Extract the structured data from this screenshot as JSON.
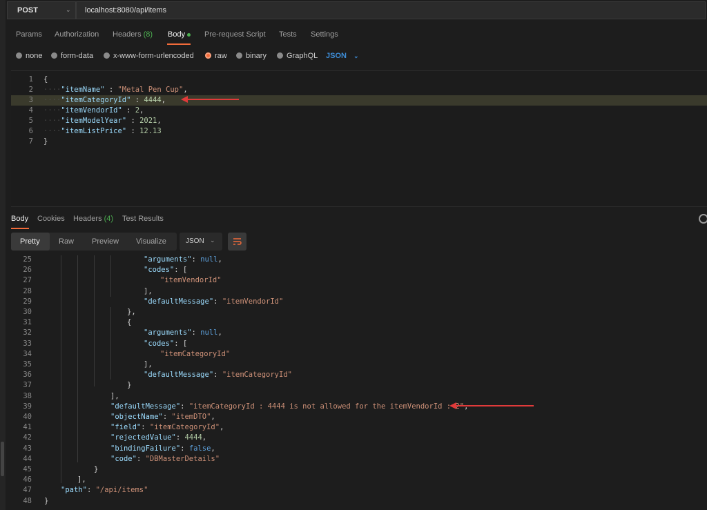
{
  "request": {
    "method": "POST",
    "url": "localhost:8080/api/items"
  },
  "request_tabs": [
    {
      "label": "Params",
      "count": null,
      "active": false
    },
    {
      "label": "Authorization",
      "count": null,
      "active": false
    },
    {
      "label": "Headers",
      "count": "(8)",
      "active": false
    },
    {
      "label": "Body",
      "count": null,
      "active": true
    },
    {
      "label": "Pre-request Script",
      "count": null,
      "active": false
    },
    {
      "label": "Tests",
      "count": null,
      "active": false
    },
    {
      "label": "Settings",
      "count": null,
      "active": false
    }
  ],
  "body_types": [
    "none",
    "form-data",
    "x-www-form-urlencoded",
    "raw",
    "binary",
    "GraphQL"
  ],
  "body_type_selected": "raw",
  "body_language": "JSON",
  "request_body": [
    {
      "n": "1",
      "text": "{"
    },
    {
      "n": "2",
      "key": "\"itemName\"",
      "sep": " : ",
      "val": "\"Metal Pen Cup\"",
      "vt": "s",
      "end": ","
    },
    {
      "n": "3",
      "key": "\"itemCategoryId\"",
      "sep": " : ",
      "val": "4444",
      "vt": "n",
      "end": ","
    },
    {
      "n": "4",
      "key": "\"itemVendorId\"",
      "sep": " : ",
      "val": "2",
      "vt": "n",
      "end": ","
    },
    {
      "n": "5",
      "key": "\"itemModelYear\"",
      "sep": " : ",
      "val": "2021",
      "vt": "n",
      "end": ","
    },
    {
      "n": "6",
      "key": "\"itemListPrice\"",
      "sep": " : ",
      "val": "12.13",
      "vt": "n",
      "end": ""
    },
    {
      "n": "7",
      "text": "}"
    }
  ],
  "response_tabs": [
    {
      "label": "Body",
      "count": null,
      "active": true
    },
    {
      "label": "Cookies",
      "count": null,
      "active": false
    },
    {
      "label": "Headers",
      "count": "(4)",
      "active": false
    },
    {
      "label": "Test Results",
      "count": null,
      "active": false
    }
  ],
  "format_tabs": [
    "Pretty",
    "Raw",
    "Preview",
    "Visualize"
  ],
  "format_selected": "Pretty",
  "response_language": "JSON",
  "response_body": [
    {
      "n": "25",
      "indent": 7,
      "key": "\"arguments\"",
      "sep": ": ",
      "val": "null",
      "vt": "kw",
      "end": ","
    },
    {
      "n": "26",
      "indent": 7,
      "key": "\"codes\"",
      "sep": ": ",
      "val": "[",
      "vt": "p",
      "end": ""
    },
    {
      "n": "27",
      "indent": 8,
      "key": "",
      "sep": "",
      "val": "\"itemVendorId\"",
      "vt": "s",
      "end": ""
    },
    {
      "n": "28",
      "indent": 7,
      "key": "",
      "sep": "",
      "val": "]",
      "vt": "p",
      "end": ","
    },
    {
      "n": "29",
      "indent": 7,
      "key": "\"defaultMessage\"",
      "sep": ": ",
      "val": "\"itemVendorId\"",
      "vt": "s",
      "end": ""
    },
    {
      "n": "30",
      "indent": 6,
      "key": "",
      "sep": "",
      "val": "}",
      "vt": "p",
      "end": ","
    },
    {
      "n": "31",
      "indent": 6,
      "key": "",
      "sep": "",
      "val": "{",
      "vt": "p",
      "end": ""
    },
    {
      "n": "32",
      "indent": 7,
      "key": "\"arguments\"",
      "sep": ": ",
      "val": "null",
      "vt": "kw",
      "end": ","
    },
    {
      "n": "33",
      "indent": 7,
      "key": "\"codes\"",
      "sep": ": ",
      "val": "[",
      "vt": "p",
      "end": ""
    },
    {
      "n": "34",
      "indent": 8,
      "key": "",
      "sep": "",
      "val": "\"itemCategoryId\"",
      "vt": "s",
      "end": ""
    },
    {
      "n": "35",
      "indent": 7,
      "key": "",
      "sep": "",
      "val": "]",
      "vt": "p",
      "end": ","
    },
    {
      "n": "36",
      "indent": 7,
      "key": "\"defaultMessage\"",
      "sep": ": ",
      "val": "\"itemCategoryId\"",
      "vt": "s",
      "end": ""
    },
    {
      "n": "37",
      "indent": 6,
      "key": "",
      "sep": "",
      "val": "}",
      "vt": "p",
      "end": ""
    },
    {
      "n": "38",
      "indent": 5,
      "key": "",
      "sep": "",
      "val": "]",
      "vt": "p",
      "end": ","
    },
    {
      "n": "39",
      "indent": 5,
      "key": "\"defaultMessage\"",
      "sep": ": ",
      "val": "\"itemCategoryId : 4444 is not allowed for the itemVendorId : 2\"",
      "vt": "s",
      "end": ","
    },
    {
      "n": "40",
      "indent": 5,
      "key": "\"objectName\"",
      "sep": ": ",
      "val": "\"itemDTO\"",
      "vt": "s",
      "end": ","
    },
    {
      "n": "41",
      "indent": 5,
      "key": "\"field\"",
      "sep": ": ",
      "val": "\"itemCategoryId\"",
      "vt": "s",
      "end": ","
    },
    {
      "n": "42",
      "indent": 5,
      "key": "\"rejectedValue\"",
      "sep": ": ",
      "val": "4444",
      "vt": "n",
      "end": ","
    },
    {
      "n": "43",
      "indent": 5,
      "key": "\"bindingFailure\"",
      "sep": ": ",
      "val": "false",
      "vt": "kw",
      "end": ","
    },
    {
      "n": "44",
      "indent": 5,
      "key": "\"code\"",
      "sep": ": ",
      "val": "\"DBMasterDetails\"",
      "vt": "s",
      "end": ""
    },
    {
      "n": "45",
      "indent": 4,
      "key": "",
      "sep": "",
      "val": "}",
      "vt": "p",
      "end": ""
    },
    {
      "n": "46",
      "indent": 3,
      "key": "",
      "sep": "",
      "val": "]",
      "vt": "p",
      "end": ","
    },
    {
      "n": "47",
      "indent": 2,
      "key": "\"path\"",
      "sep": ": ",
      "val": "\"/api/items\"",
      "vt": "s",
      "end": ""
    },
    {
      "n": "48",
      "indent": 1,
      "key": "",
      "sep": "",
      "val": "}",
      "vt": "p",
      "end": ""
    }
  ],
  "colors": {
    "accent": "#f26b3a",
    "annotation_arrow": "#e03a3a",
    "json_key": "#9cdcfe",
    "json_string": "#ce9178",
    "json_number": "#b5cea8"
  }
}
